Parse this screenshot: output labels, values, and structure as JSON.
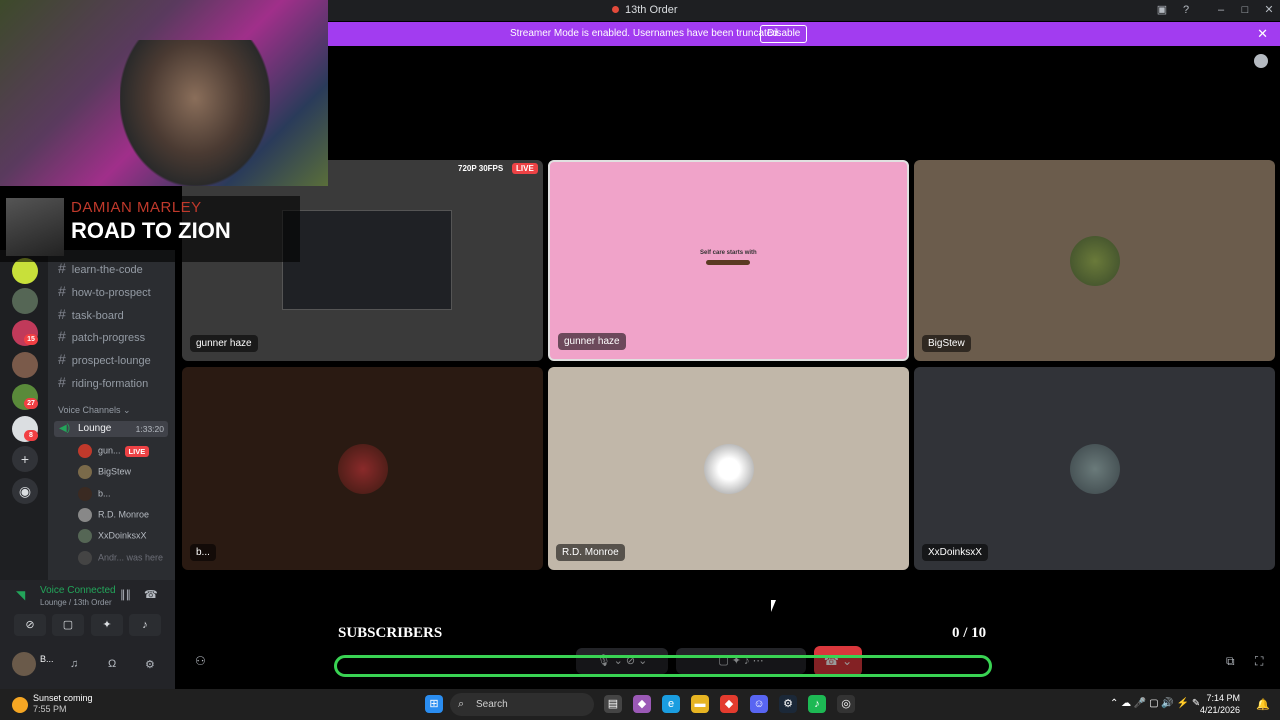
{
  "window": {
    "title": "13th Order"
  },
  "banner": {
    "message": "Streamer Mode is enabled. Usernames have been truncated.",
    "disable_label": "Disable"
  },
  "overlay": {
    "artist": "DAMIAN MARLEY",
    "song": "ROAD TO ZION",
    "subscribers_label": "SUBSCRIBERS",
    "subscribers_count": "0 / 10",
    "subscribers_progress": 0
  },
  "sidebar": {
    "server_badges": [
      "15",
      "27",
      "8"
    ],
    "text_channels": [
      "learn-the-code",
      "how-to-prospect",
      "task-board",
      "patch-progress",
      "prospect-lounge",
      "riding-formation"
    ],
    "voice_header": "Voice Channels",
    "voice_channel": {
      "name": "Lounge",
      "time": "1:33:20"
    },
    "voice_users": [
      {
        "name": "gun...",
        "tag": "LIVE",
        "color": "#c0392b"
      },
      {
        "name": "BigStew",
        "tag": "",
        "color": "#7a6a4a"
      },
      {
        "name": "b...",
        "tag": "",
        "color": "#3a2a22"
      },
      {
        "name": "R.D. Monroe",
        "tag": "",
        "color": "#888888"
      },
      {
        "name": "XxDoinksxX",
        "tag": "",
        "color": "#556655"
      },
      {
        "name": "Andr...",
        "tag": "was here",
        "color": "#444444"
      }
    ]
  },
  "voice_panel": {
    "status": "Voice Connected",
    "location": "Lounge / 13th Order",
    "user": "B..."
  },
  "tiles": [
    {
      "label": "gunner haze",
      "stream_quality": "720P 30FPS",
      "live": "LIVE",
      "bg": "#3a3a3a"
    },
    {
      "label": "gunner haze",
      "caption": "Self care starts with",
      "bg": "#f0a3c9"
    },
    {
      "label": "BigStew",
      "bg": "#6b5c4c"
    },
    {
      "label": "b...",
      "bg": "#2a1a12"
    },
    {
      "label": "R.D. Monroe",
      "bg": "#c1b7a9"
    },
    {
      "label": "XxDoinksxX",
      "bg": "#313338"
    }
  ],
  "taskbar": {
    "weather_line1": "Sunset coming",
    "weather_line2": "7:55 PM",
    "search_label": "Search",
    "time": "7:14 PM",
    "date": "4/21/2026"
  }
}
